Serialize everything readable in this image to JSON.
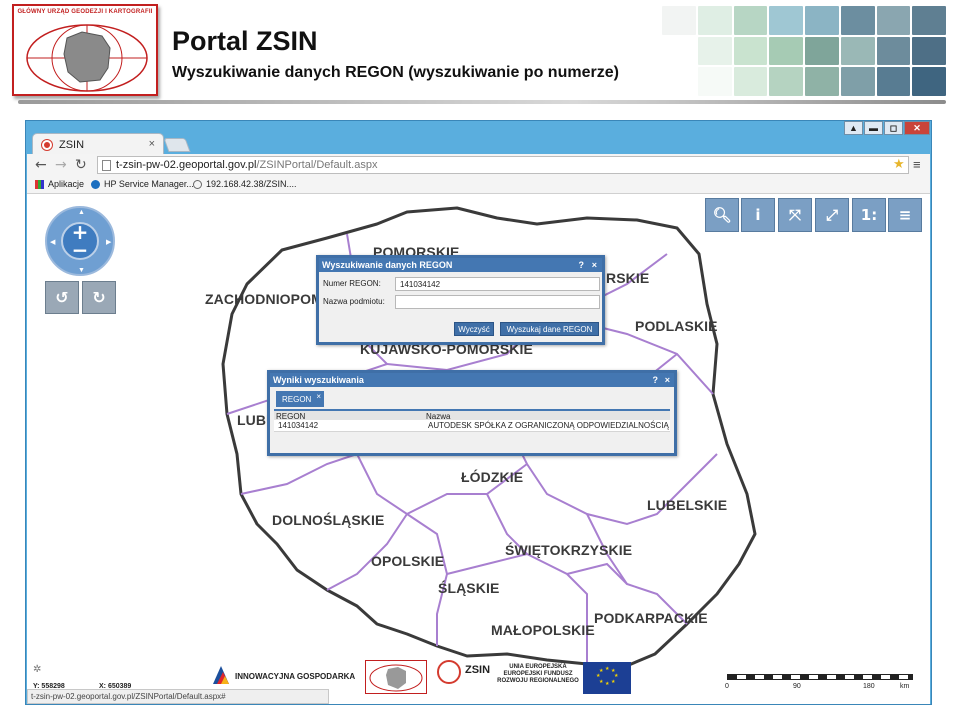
{
  "slide": {
    "title": "Portal ZSIN",
    "subtitle": "Wyszukiwanie danych REGON (wyszukiwanie po numerze)",
    "logo_text": "GŁÓWNY URZĄD GEODEZJI I KARTOGRAFII"
  },
  "browser": {
    "tab_title": "ZSIN",
    "tab_close": "×",
    "url_host": "t-zsin-pw-02.geoportal.gov.pl",
    "url_path": "/ZSINPortal/Default.aspx",
    "window_controls": [
      "▲",
      "▬",
      "◻",
      "✕"
    ],
    "bookmarks": [
      {
        "label": "Aplikacje",
        "icon": "apps-grid-icon"
      },
      {
        "label": "HP Service Manager...",
        "icon": "hp-icon"
      },
      {
        "label": "192.168.42.38/ZSIN....",
        "icon": "search-page-icon"
      }
    ]
  },
  "map": {
    "regions": [
      {
        "name": "POMORSKIE"
      },
      {
        "name": "ZACHODNIOPOM"
      },
      {
        "name": "RSKIE"
      },
      {
        "name": "PODLASKIE"
      },
      {
        "name": "KUJAWSKO-POMORSKIE"
      },
      {
        "name": "LUBU"
      },
      {
        "name": "ŁÓDZKIE"
      },
      {
        "name": "LUBELSKIE"
      },
      {
        "name": "DOLNOŚLĄSKIE"
      },
      {
        "name": "OPOLSKIE"
      },
      {
        "name": "ŚWIĘTOKRZYSKIE"
      },
      {
        "name": "ŚLĄSKIE"
      },
      {
        "name": "PODKARPACKIE"
      },
      {
        "name": "MAŁOPOLSKIE"
      }
    ],
    "zoom_in": "+",
    "zoom_out": "−",
    "tools": [
      {
        "name": "search-tool",
        "glyph": "🔍︎"
      },
      {
        "name": "info-tool",
        "glyph": "i"
      },
      {
        "name": "full-extent-tool",
        "glyph": "⤧"
      },
      {
        "name": "fullscreen-tool",
        "glyph": "⤢"
      },
      {
        "name": "scale-tool",
        "glyph": "1:"
      },
      {
        "name": "menu-tool",
        "glyph": "≡"
      }
    ],
    "rotate_left": "↺",
    "rotate_right": "↻"
  },
  "search_dialog": {
    "title": "Wyszukiwanie danych REGON",
    "help": "?",
    "close": "×",
    "regon_label": "Numer REGON:",
    "regon_value": "141034142",
    "name_label": "Nazwa podmiotu:",
    "name_value": "",
    "clear_button": "Wyczyść",
    "search_button": "Wyszukaj dane REGON"
  },
  "results_dialog": {
    "title": "Wyniki wyszukiwania",
    "help": "?",
    "close": "×",
    "tab_label": "REGON",
    "tab_close": "×",
    "columns": [
      "REGON",
      "Nazwa"
    ],
    "rows": [
      {
        "regon": "141034142",
        "nazwa": "AUTODESK SPÓŁKA Z OGRANICZONĄ ODPOWIEDZIALNOŚCIĄ"
      }
    ]
  },
  "footer": {
    "y_coord": "Y: 558298",
    "x_coord": "X: 650389",
    "status_url": "t-zsin-pw-02.geoportal.gov.pl/ZSINPortal/Default.aspx#",
    "innowacyjna": "INNOWACYJNA GOSPODARKA",
    "zsin_logo": "ZSIN",
    "eu_text": "UNIA EUROPEJSKA\nEUROPEJSKI FUNDUSZ\nROZWOJU REGIONALNEGO",
    "scale_labels": [
      "0",
      "90",
      "180",
      "km"
    ]
  }
}
